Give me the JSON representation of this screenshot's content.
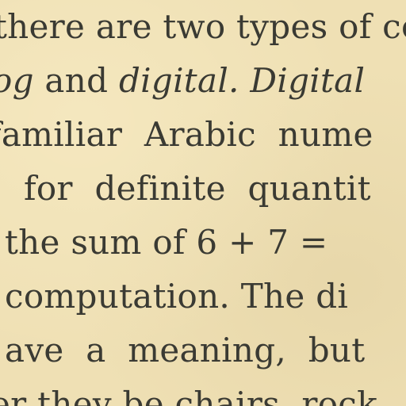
{
  "document": {
    "lines": [
      {
        "text": "there are two types of co"
      },
      {
        "parts": [
          {
            "text": "og",
            "italic": true
          },
          {
            "text": " and ",
            "italic": false
          },
          {
            "text": "digital. Digital",
            "italic": true
          }
        ]
      },
      {
        "words": [
          "familiar",
          "Arabic",
          "nume"
        ]
      },
      {
        "words": [
          "for",
          "definite",
          "quantit"
        ]
      },
      {
        "text": "the sum of 6 + 7 ="
      },
      {
        "text": "computation. The di"
      },
      {
        "words": [
          "ave",
          "a",
          "meaning,",
          "but"
        ]
      },
      {
        "text": "er they be chairs, rock"
      }
    ]
  }
}
